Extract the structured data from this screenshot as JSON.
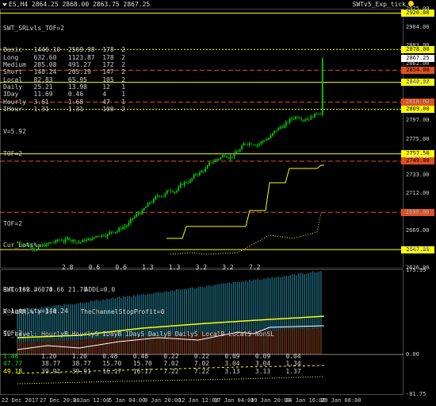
{
  "titlebar": {
    "symbol": "ES,H4",
    "ohlc": "2864.25 2868.00 2863.75 2867.25",
    "indicator": "SWTv5_Exp_tick"
  },
  "info_panel": {
    "header": "SWT_SRLvls_TOF=2",
    "rows": [
      {
        "name": "Basic",
        "v1": "1446.10",
        "v2": "2569.98",
        "v3": "178",
        "v4": "2"
      },
      {
        "name": "Long",
        "v1": "632.60",
        "v2": "1123.87",
        "v3": "178",
        "v4": "2"
      },
      {
        "name": "Medium",
        "v1": "285.08",
        "v2": "491.27",
        "v3": "172",
        "v4": "2"
      },
      {
        "name": "Short",
        "v1": "140.24",
        "v2": "205.19",
        "v3": "147",
        "v4": "2"
      },
      {
        "name": "Local",
        "v1": "82.83",
        "v2": "65.95",
        "v3": "105",
        "v4": "2"
      },
      {
        "name": "Daily",
        "v1": "25.21",
        "v2": "13.98",
        "v3": "12",
        "v4": "1"
      },
      {
        "name": "IDay",
        "v1": "11.69",
        "v2": "0.46",
        "v3": "4",
        "v4": "1"
      },
      {
        "name": "Hourly",
        "v1": "3.61",
        "v2": "1.68",
        "v3": "47",
        "v4": "1"
      },
      {
        "name": "IHour",
        "v1": "1.31",
        "v2": "1.31",
        "v3": "100",
        "v4": "2"
      }
    ],
    "vol": "V=5.92",
    "tof": "TOF=2"
  },
  "lower_overlay": {
    "tof": "TOF=2",
    "cur": "Cur_Lots%=",
    "row_a": "2.8    0.6    0.6    1.3    1.3    3.2    3.2    7.2",
    "rlots": "R/Lots% = 0.0",
    "addl": "ADDL=0.0",
    "rmm": "R_AuMM,% = 3.4",
    "channel": "TheChannelStopProfit=0",
    "level_header": "SL_Level: HourlyB HourlyS IDayB IDayS DailyB DailyS LocalB LocalS NonSL",
    "level_rows": [
      {
        "label": "1.48",
        "color": "#00e000",
        "vals": "1.20    1.20    0.48    0.48    0.22    0.22    0.09    0.09    0.04"
      },
      {
        "label": "47.77",
        "color": "#00e000",
        "vals": "38.77   38.77   15.70   15.70   7.02    7.02    3.04    3.04    1.34"
      },
      {
        "label": "49.18",
        "color": "#ffff00",
        "vals": "39.91   39.91   16.17   16.17   7.22    7.22    3.13    3.13    1.37"
      }
    ]
  },
  "price_axis": {
    "ticks": [
      "2925.00",
      "2904.00",
      "2883.00",
      "2862.00",
      "2840.00",
      "2818.00",
      "2797.00",
      "2775.00",
      "2754.00",
      "2733.00",
      "2712.00",
      "2690.00",
      "2669.00",
      "2648.00",
      "2626.00"
    ],
    "tags": [
      {
        "label": "2920.00",
        "color": "#ffff00",
        "price": 2920
      },
      {
        "label": "2878.00",
        "color": "#ffff00",
        "price": 2878
      },
      {
        "label": "2867.25",
        "color": "#ffffff",
        "price": 2867.25
      },
      {
        "label": "2854.00",
        "color": "#e05020",
        "price": 2854
      },
      {
        "label": "2840.00",
        "color": "#ffff00",
        "price": 2840
      },
      {
        "label": "2817.25",
        "color": "#e05020",
        "price": 2817.25
      },
      {
        "label": "2809.00",
        "color": "#ffff00",
        "price": 2809
      },
      {
        "label": "2757.50",
        "color": "#ffff00",
        "price": 2757.5
      },
      {
        "label": "2749.00",
        "color": "#e05020",
        "price": 2749
      },
      {
        "label": "2690.00",
        "color": "#e05020",
        "price": 2690
      },
      {
        "label": "2647.00",
        "color": "#ffff00",
        "price": 2647
      }
    ]
  },
  "sub_window": {
    "header": "SWT 162.36 74.66 21.78",
    "volatility": "Volatility=140.24",
    "tof": "TOF=2",
    "axis": [
      "173.99",
      "0.00",
      "-81.75"
    ]
  },
  "time_axis": [
    "22 Dec 2017",
    "27 Dec 20:00",
    "2 Jan 12:00",
    "5 Jan 04:00",
    "9 Jan 20:00",
    "12 Jan 12:00",
    "17 Jan 04:00",
    "19 Jan 20:00",
    "24 Jan 16:00",
    "29 Jan 08:00"
  ],
  "colors": {
    "bull": "#00d000",
    "bear": "#00a000",
    "level_yellow": "#ffff00",
    "level_red": "#e05020",
    "hist_teal": "#1e6b7e",
    "hist_brown": "#6b2a10"
  }
}
